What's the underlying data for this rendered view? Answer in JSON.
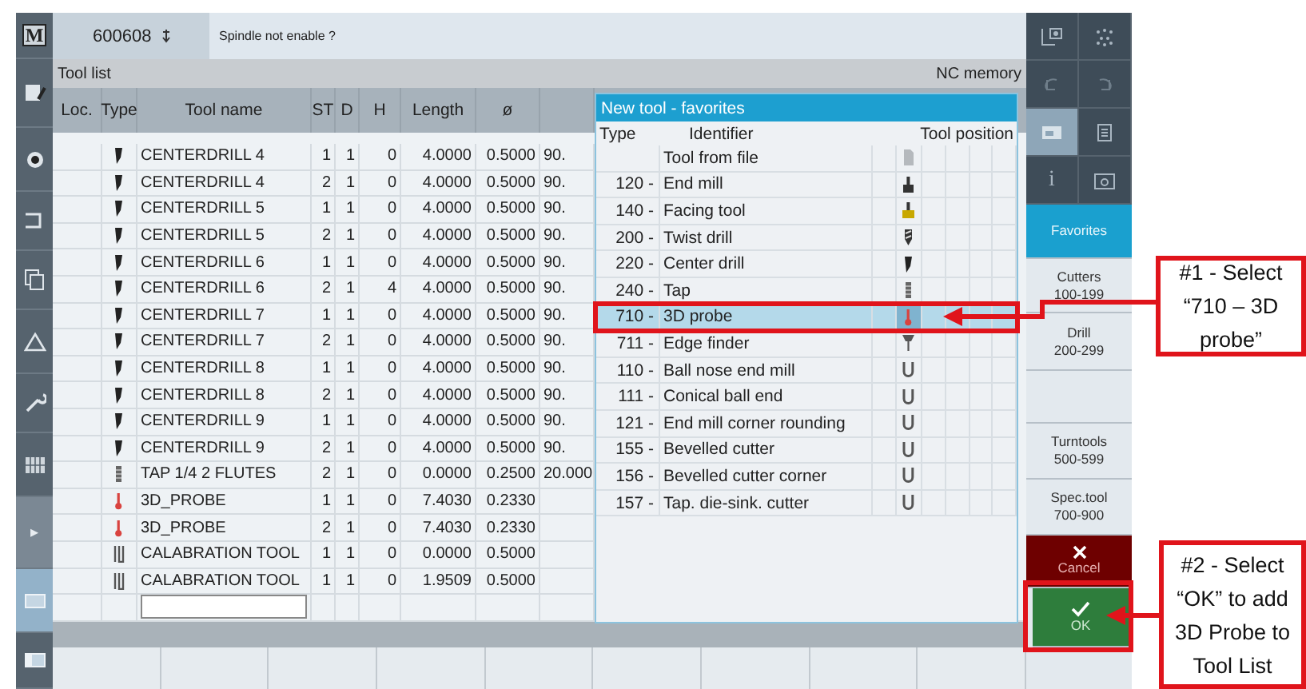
{
  "left_bar": [
    {
      "kind": "tool",
      "glyph": "M",
      "selected": false
    },
    {
      "kind": "tool",
      "selected": false
    },
    {
      "kind": "tool",
      "selected": false
    },
    {
      "kind": "tool",
      "selected": false
    },
    {
      "kind": "tool",
      "selected": false
    },
    {
      "kind": "tool",
      "selected": false
    },
    {
      "kind": "tool",
      "selected": false
    },
    {
      "kind": "tool",
      "selected": false
    },
    {
      "kind": "expand",
      "glyph": "▸",
      "selected": false
    },
    {
      "kind": "tool",
      "selected": true
    },
    {
      "kind": "tool",
      "selected": false
    }
  ],
  "header": {
    "program": "600608",
    "message": "Spindle not enable ?"
  },
  "tool_list": {
    "title": "Tool list",
    "memory": "NC memory",
    "columns": [
      "Loc.",
      "Type",
      "Tool name",
      "ST",
      "D",
      "H",
      "Length",
      "ø"
    ],
    "rows": [
      {
        "kind": "centerdrill",
        "name": "CENTERDRILL 4",
        "st": "1",
        "d": "1",
        "h": "0",
        "length": "4.0000",
        "diameter": "0.5000",
        "column_9": "90."
      },
      {
        "kind": "centerdrill",
        "name": "CENTERDRILL 4",
        "st": "2",
        "d": "1",
        "h": "0",
        "length": "4.0000",
        "diameter": "0.5000",
        "column_9": "90."
      },
      {
        "kind": "centerdrill",
        "name": "CENTERDRILL 5",
        "st": "1",
        "d": "1",
        "h": "0",
        "length": "4.0000",
        "diameter": "0.5000",
        "column_9": "90."
      },
      {
        "kind": "centerdrill",
        "name": "CENTERDRILL 5",
        "st": "2",
        "d": "1",
        "h": "0",
        "length": "4.0000",
        "diameter": "0.5000",
        "column_9": "90."
      },
      {
        "kind": "centerdrill",
        "name": "CENTERDRILL 6",
        "st": "1",
        "d": "1",
        "h": "0",
        "length": "4.0000",
        "diameter": "0.5000",
        "column_9": "90."
      },
      {
        "kind": "centerdrill",
        "name": "CENTERDRILL 6",
        "st": "2",
        "d": "1",
        "h": "4",
        "length": "4.0000",
        "diameter": "0.5000",
        "column_9": "90."
      },
      {
        "kind": "centerdrill",
        "name": "CENTERDRILL 7",
        "st": "1",
        "d": "1",
        "h": "0",
        "length": "4.0000",
        "diameter": "0.5000",
        "column_9": "90."
      },
      {
        "kind": "centerdrill",
        "name": "CENTERDRILL 7",
        "st": "2",
        "d": "1",
        "h": "0",
        "length": "4.0000",
        "diameter": "0.5000",
        "column_9": "90."
      },
      {
        "kind": "centerdrill",
        "name": "CENTERDRILL 8",
        "st": "1",
        "d": "1",
        "h": "0",
        "length": "4.0000",
        "diameter": "0.5000",
        "column_9": "90."
      },
      {
        "kind": "centerdrill",
        "name": "CENTERDRILL 8",
        "st": "2",
        "d": "1",
        "h": "0",
        "length": "4.0000",
        "diameter": "0.5000",
        "column_9": "90."
      },
      {
        "kind": "centerdrill",
        "name": "CENTERDRILL 9",
        "st": "1",
        "d": "1",
        "h": "0",
        "length": "4.0000",
        "diameter": "0.5000",
        "column_9": "90."
      },
      {
        "kind": "centerdrill",
        "name": "CENTERDRILL 9",
        "st": "2",
        "d": "1",
        "h": "0",
        "length": "4.0000",
        "diameter": "0.5000",
        "column_9": "90."
      },
      {
        "kind": "tap",
        "name": "TAP 1/4 2 FLUTES",
        "st": "2",
        "d": "1",
        "h": "0",
        "length": "0.0000",
        "diameter": "0.2500",
        "column_9": "20.000"
      },
      {
        "kind": "probe",
        "name": "3D_PROBE",
        "st": "1",
        "d": "1",
        "h": "0",
        "length": "7.4030",
        "diameter": "0.2330"
      },
      {
        "kind": "probe",
        "name": "3D_PROBE",
        "st": "2",
        "d": "1",
        "h": "0",
        "length": "7.4030",
        "diameter": "0.2330"
      },
      {
        "kind": "calibration",
        "name": "CALABRATION TOOL",
        "st": "1",
        "d": "1",
        "h": "0",
        "length": "0.0000",
        "diameter": "0.5000"
      },
      {
        "kind": "calibration",
        "name": "CALABRATION TOOL",
        "st": "1",
        "d": "1",
        "h": "0",
        "length": "1.9509",
        "diameter": "0.5000"
      }
    ]
  },
  "dialog": {
    "title": "New tool - favorites",
    "columns": [
      "Type",
      "Identifier",
      "Tool position"
    ],
    "items": [
      {
        "name": "Tool from file",
        "kind": "file",
        "selected": false
      },
      {
        "number": "120 -",
        "name": "End mill",
        "kind": "endmill",
        "selected": false
      },
      {
        "number": "140 -",
        "name": "Facing tool",
        "kind": "facing",
        "selected": false
      },
      {
        "number": "200 -",
        "name": "Twist drill",
        "kind": "twist",
        "selected": false
      },
      {
        "number": "220 -",
        "name": "Center drill",
        "kind": "centerdrill",
        "selected": false
      },
      {
        "number": "240 -",
        "name": "Tap",
        "kind": "tap",
        "selected": false
      },
      {
        "number": "710 -",
        "name": "3D probe",
        "kind": "probe",
        "selected": true
      },
      {
        "number": "711 -",
        "name": "Edge finder",
        "kind": "edgefinder",
        "selected": false
      },
      {
        "number": "110 -",
        "name": "Ball nose end mill",
        "kind": "ball",
        "selected": false
      },
      {
        "number": "111 -",
        "name": "Conical ball end",
        "kind": "ball",
        "selected": false
      },
      {
        "number": "121 -",
        "name": "End mill corner rounding",
        "kind": "ball",
        "selected": false
      },
      {
        "number": "155 -",
        "name": "Bevelled cutter",
        "kind": "ball",
        "selected": false
      },
      {
        "number": "156 -",
        "name": "Bevelled cutter corner",
        "kind": "ball",
        "selected": false
      },
      {
        "number": "157 -",
        "name": "Tap. die-sink. cutter",
        "kind": "ball",
        "selected": false
      }
    ]
  },
  "sidebar": {
    "icons": [
      {
        "selected": false
      },
      {
        "selected": false
      },
      {
        "selected": false
      },
      {
        "selected": false
      },
      {
        "selected": true
      },
      {
        "selected": false
      },
      {
        "glyph": "i",
        "selected": false
      },
      {
        "selected": false
      }
    ],
    "softkeys": [
      {
        "kind": "normal",
        "lines": [
          "Favorites"
        ],
        "selected": true
      },
      {
        "kind": "normal",
        "lines": [
          "Cutters",
          "100-199"
        ],
        "selected": false
      },
      {
        "kind": "normal",
        "lines": [
          "Drill",
          "200-299"
        ],
        "selected": false
      },
      {
        "kind": "normal",
        "selected": false
      },
      {
        "kind": "normal",
        "lines": [
          "Turntools",
          "500-599"
        ],
        "selected": false
      },
      {
        "kind": "normal",
        "lines": [
          "Spec.tool",
          "700-900"
        ],
        "selected": false
      },
      {
        "kind": "cancel",
        "label": "Cancel",
        "selected": false
      },
      {
        "kind": "ok",
        "label": "OK",
        "selected": false
      }
    ]
  },
  "annotations": [
    {
      "text": "#1 - Select “710 – 3D probe”"
    },
    {
      "text": "#2 - Select “OK” to add 3D Probe to Tool List"
    }
  ]
}
